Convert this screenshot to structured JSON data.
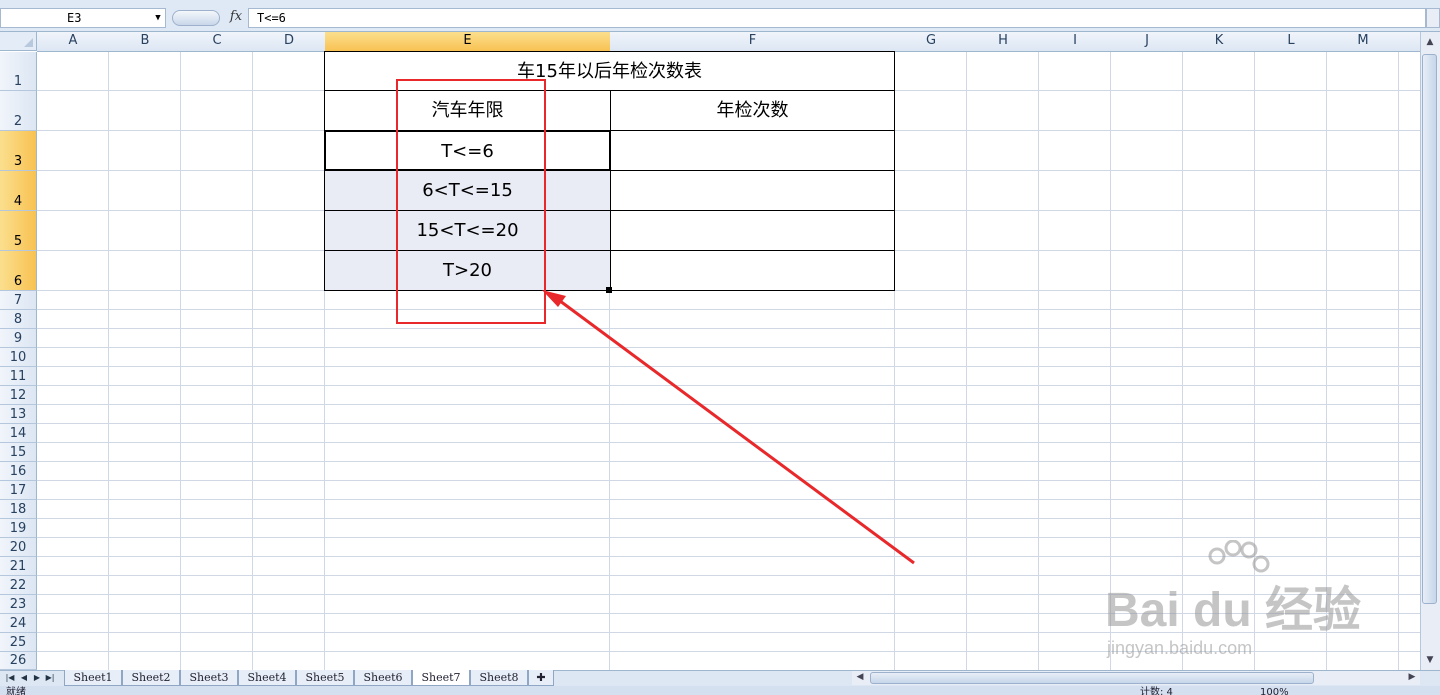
{
  "formula_bar": {
    "name_box": "E3",
    "fx_label": "fx",
    "formula": "T<=6"
  },
  "columns": [
    "A",
    "B",
    "C",
    "D",
    "E",
    "F",
    "G",
    "H",
    "I",
    "J",
    "K",
    "L",
    "M"
  ],
  "selected_column": "E",
  "rows": [
    "1",
    "2",
    "3",
    "4",
    "5",
    "6",
    "7",
    "8",
    "9",
    "10",
    "11",
    "12",
    "13",
    "14",
    "15",
    "16",
    "17",
    "18",
    "19",
    "20",
    "21",
    "22",
    "23",
    "24",
    "25",
    "26"
  ],
  "selected_rows": [
    "3",
    "4",
    "5",
    "6"
  ],
  "table": {
    "title": "车15年以后年检次数表",
    "header_col_e": "汽车年限",
    "header_col_f": "年检次数",
    "col_e_values": [
      "T<=6",
      "6<T<=15",
      "15<T<=20",
      "T>20"
    ],
    "col_f_values": [
      "",
      "",
      "",
      ""
    ]
  },
  "sheets": [
    "Sheet1",
    "Sheet2",
    "Sheet3",
    "Sheet4",
    "Sheet5",
    "Sheet6",
    "Sheet7",
    "Sheet8"
  ],
  "active_sheet": "Sheet7",
  "status_bar": {
    "ready": "就绪",
    "count": "计数: 4",
    "zoom": "100%"
  },
  "watermark": {
    "brand": "Bai du 经验",
    "url": "jingyan.baidu.com"
  },
  "annotation": {
    "highlight_color": "#e8282a"
  }
}
